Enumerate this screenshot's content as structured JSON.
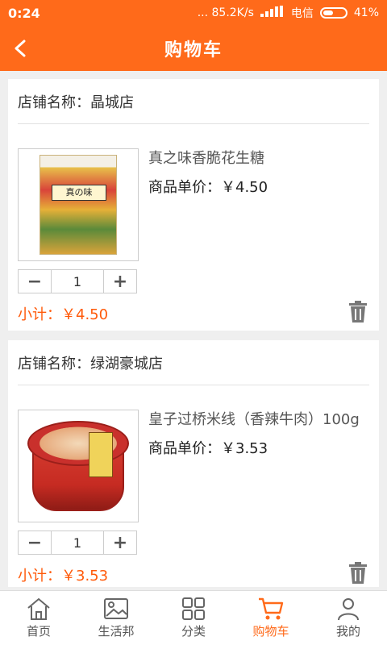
{
  "status_bar": {
    "time": "0:24",
    "network_speed": "... 85.2K/s",
    "carrier": "电信",
    "battery": "41%"
  },
  "header": {
    "title": "购物车",
    "back_icon": "chevron-left-icon"
  },
  "stores": [
    {
      "store_label": "店铺名称：晶城店",
      "items": [
        {
          "name": "真之味香脆花生糖",
          "unit_price": "商品单价：￥4.50",
          "quantity": "1",
          "package_text": "真の味"
        }
      ],
      "subtotal": "小计：￥4.50"
    },
    {
      "store_label": "店铺名称：绿湖豪城店",
      "items": [
        {
          "name": "皇子过桥米线（香辣牛肉）100g",
          "unit_price": "商品单价：￥3.53",
          "quantity": "1"
        }
      ],
      "subtotal": "小计：￥3.53"
    }
  ],
  "qty_controls": {
    "minus": "−",
    "plus": "+"
  },
  "bottom_nav": {
    "items": [
      {
        "label": "首页",
        "icon": "home-icon"
      },
      {
        "label": "生活邦",
        "icon": "image-icon"
      },
      {
        "label": "分类",
        "icon": "grid-icon"
      },
      {
        "label": "购物车",
        "icon": "cart-icon",
        "active": true
      },
      {
        "label": "我的",
        "icon": "user-icon"
      }
    ]
  },
  "colors": {
    "accent": "#ff6a1a",
    "subtotal": "#ff5a0a"
  }
}
